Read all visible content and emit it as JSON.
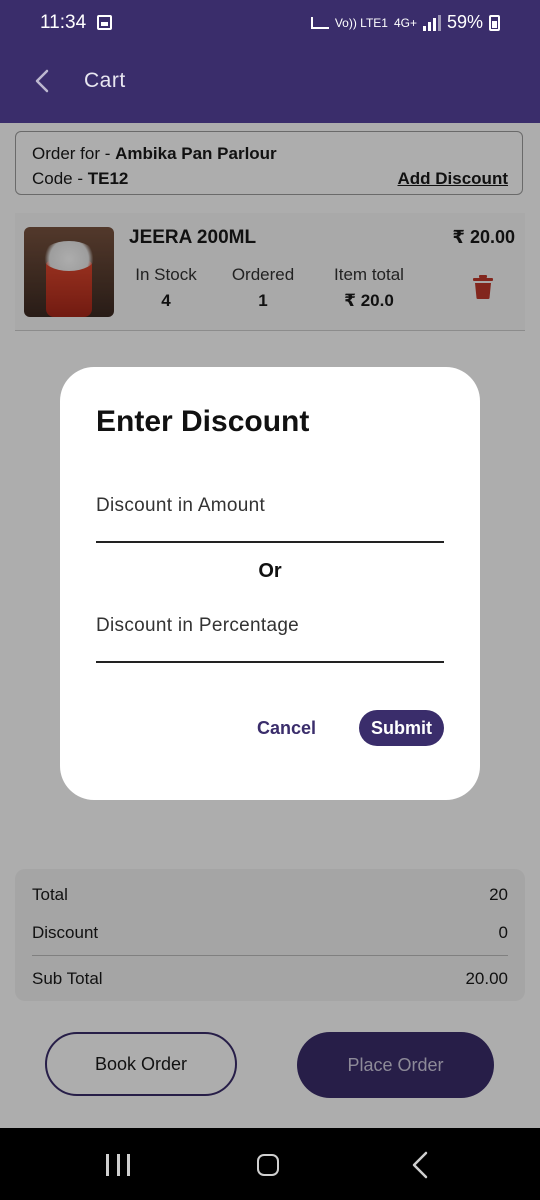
{
  "status_bar": {
    "time": "11:34",
    "network_volte": "Vo)) LTE1",
    "network_type": "4G+",
    "battery": "59%"
  },
  "app_bar": {
    "title": "Cart",
    "back_icon": "chevron-left-icon"
  },
  "order": {
    "order_for_label": "Order for - ",
    "order_for_value": "Ambika Pan Parlour",
    "code_label": "Code - ",
    "code_value": "TE12",
    "add_discount_label": "Add Discount"
  },
  "item": {
    "name": "JEERA 200ML",
    "price": "₹ 20.00",
    "in_stock_label": "In Stock",
    "in_stock_value": "4",
    "ordered_label": "Ordered",
    "ordered_value": "1",
    "item_total_label": "Item total",
    "item_total_value": "₹ 20.0",
    "delete_icon": "trash-icon",
    "delete_color": "#c0392b"
  },
  "summary": {
    "total_label": "Total",
    "total_value": "20",
    "discount_label": "Discount",
    "discount_value": "0",
    "subtotal_label": "Sub Total",
    "subtotal_value": "20.00"
  },
  "actions": {
    "book_order_label": "Book Order",
    "place_order_label": "Place Order"
  },
  "dialog": {
    "title": "Enter Discount",
    "amount_placeholder": "Discount in Amount",
    "or_label": "Or",
    "percentage_placeholder": "Discount in Percentage",
    "cancel_label": "Cancel",
    "submit_label": "Submit"
  },
  "nav_bar": {
    "recent_icon": "recent-apps-icon",
    "home_icon": "home-icon",
    "back_icon": "back-icon"
  },
  "colors": {
    "primary": "#3a2d6b",
    "surface": "#ffffff"
  }
}
